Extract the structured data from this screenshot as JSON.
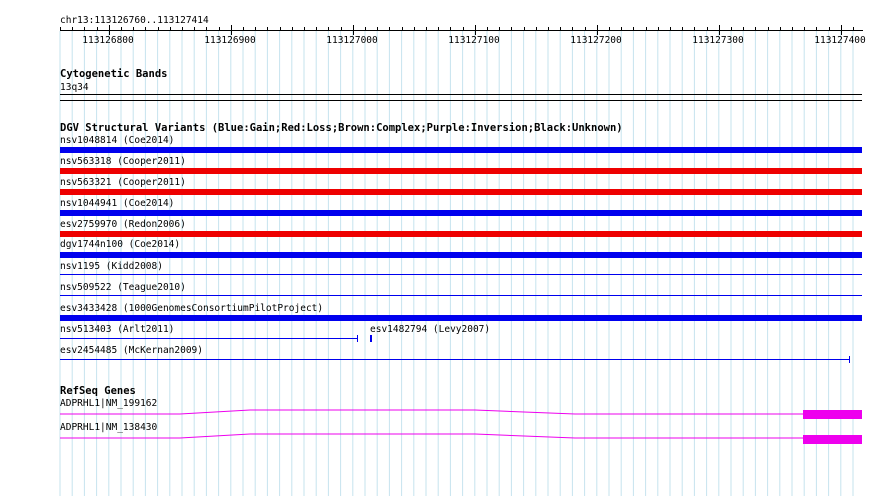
{
  "location": "chr13:113126760..113127414",
  "ruler": {
    "ticks": [
      "113126800",
      "113126900",
      "113127000",
      "113127100",
      "113127200",
      "113127300",
      "113127400"
    ]
  },
  "cytoband": {
    "title": "Cytogenetic Bands",
    "band": "13q34"
  },
  "dgv": {
    "title": "DGV Structural Variants (Blue:Gain;Red:Loss;Brown:Complex;Purple:Inversion;Black:Unknown)",
    "colors": {
      "gain": "#0000ee",
      "loss": "#ee0000"
    },
    "variants": [
      {
        "label": "nsv1048814 (Coe2014)",
        "type": "gain"
      },
      {
        "label": "nsv563318 (Cooper2011)",
        "type": "loss"
      },
      {
        "label": "nsv563321 (Cooper2011)",
        "type": "loss"
      },
      {
        "label": "nsv1044941 (Coe2014)",
        "type": "gain"
      },
      {
        "label": "esv2759970 (Redon2006)",
        "type": "loss"
      },
      {
        "label": "dgv1744n100 (Coe2014)",
        "type": "gain"
      },
      {
        "label": "nsv1195 (Kidd2008)",
        "type": "gain"
      },
      {
        "label": "nsv509522 (Teague2010)",
        "type": "gain"
      },
      {
        "label": "esv3433428 (1000GenomesConsortiumPilotProject)",
        "type": "gain"
      },
      {
        "label": "nsv513403 (Arlt2011)",
        "type": "gain"
      },
      {
        "label": "esv1482794 (Levy2007)",
        "type": "gain"
      },
      {
        "label": "esv2454485 (McKernan2009)",
        "type": "gain"
      }
    ]
  },
  "refseq": {
    "title": "RefSeq Genes",
    "color": "#ee00ee",
    "genes": [
      {
        "label": "ADPRHL1|NM_199162"
      },
      {
        "label": "ADPRHL1|NM_138430"
      }
    ]
  }
}
